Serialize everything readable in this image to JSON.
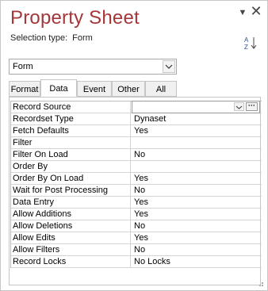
{
  "panel": {
    "title": "Property Sheet",
    "selection_type_label": "Selection type:",
    "selection_type_value": "Form",
    "pin_icon": "pin-dropdown-icon",
    "close_icon": "close-icon",
    "sort_icon": "sort-az-icon"
  },
  "object_selector": {
    "value": "Form"
  },
  "tabs": [
    {
      "label": "Format",
      "active": false
    },
    {
      "label": "Data",
      "active": true
    },
    {
      "label": "Event",
      "active": false
    },
    {
      "label": "Other",
      "active": false
    },
    {
      "label": "All",
      "active": false
    }
  ],
  "properties": [
    {
      "name": "Record Source",
      "value": ""
    },
    {
      "name": "Recordset Type",
      "value": "Dynaset"
    },
    {
      "name": "Fetch Defaults",
      "value": "Yes"
    },
    {
      "name": "Filter",
      "value": ""
    },
    {
      "name": "Filter On Load",
      "value": "No"
    },
    {
      "name": "Order By",
      "value": ""
    },
    {
      "name": "Order By On Load",
      "value": "Yes"
    },
    {
      "name": "Wait for Post Processing",
      "value": "No"
    },
    {
      "name": "Data Entry",
      "value": "Yes"
    },
    {
      "name": "Allow Additions",
      "value": "Yes"
    },
    {
      "name": "Allow Deletions",
      "value": "No"
    },
    {
      "name": "Allow Edits",
      "value": "Yes"
    },
    {
      "name": "Allow Filters",
      "value": "No"
    },
    {
      "name": "Record Locks",
      "value": "No Locks"
    }
  ],
  "colors": {
    "title": "#a4373a",
    "border": "#c6c6c6"
  }
}
